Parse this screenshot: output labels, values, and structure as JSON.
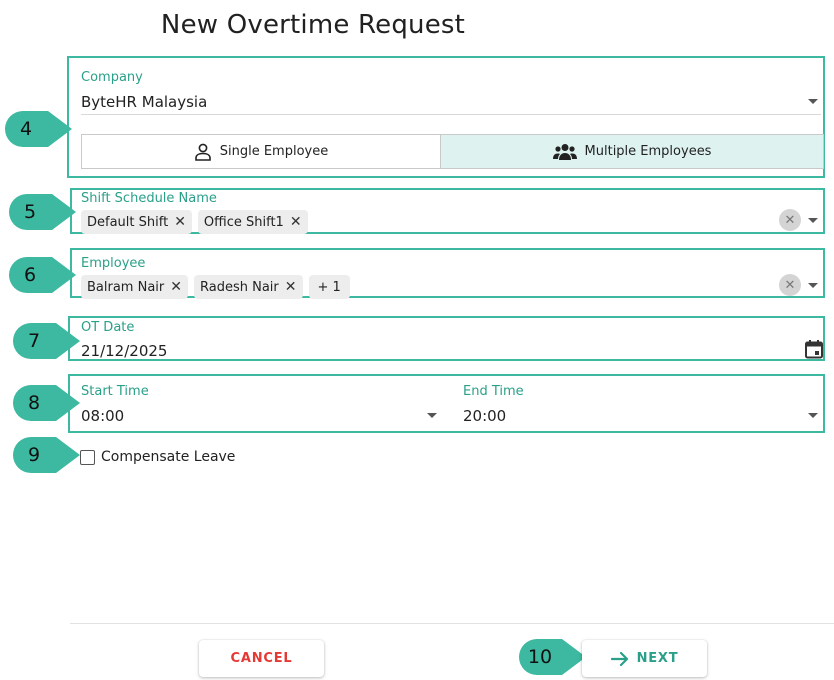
{
  "title": "New Overtime Request",
  "company": {
    "label": "Company",
    "value": "ByteHR Malaysia"
  },
  "mode": {
    "single_label": "Single Employee",
    "multiple_label": "Multiple Employees",
    "selected": "multiple"
  },
  "shift": {
    "label": "Shift Schedule Name",
    "chips": [
      "Default Shift",
      "Office Shift1"
    ]
  },
  "employee": {
    "label": "Employee",
    "chips": [
      "Balram Nair",
      "Radesh Nair"
    ],
    "more": "+ 1"
  },
  "ot_date": {
    "label": "OT Date",
    "value": "21/12/2025"
  },
  "start_time": {
    "label": "Start Time",
    "value": "08:00"
  },
  "end_time": {
    "label": "End Time",
    "value": "20:00"
  },
  "compensate": {
    "label": "Compensate Leave",
    "checked": false
  },
  "buttons": {
    "cancel": "CANCEL",
    "next": "NEXT"
  },
  "steps": [
    "4",
    "5",
    "6",
    "7",
    "8",
    "9",
    "10"
  ],
  "colors": {
    "accent": "#3cb9a0",
    "cancel": "#e53935",
    "label": "#2aa08a"
  }
}
